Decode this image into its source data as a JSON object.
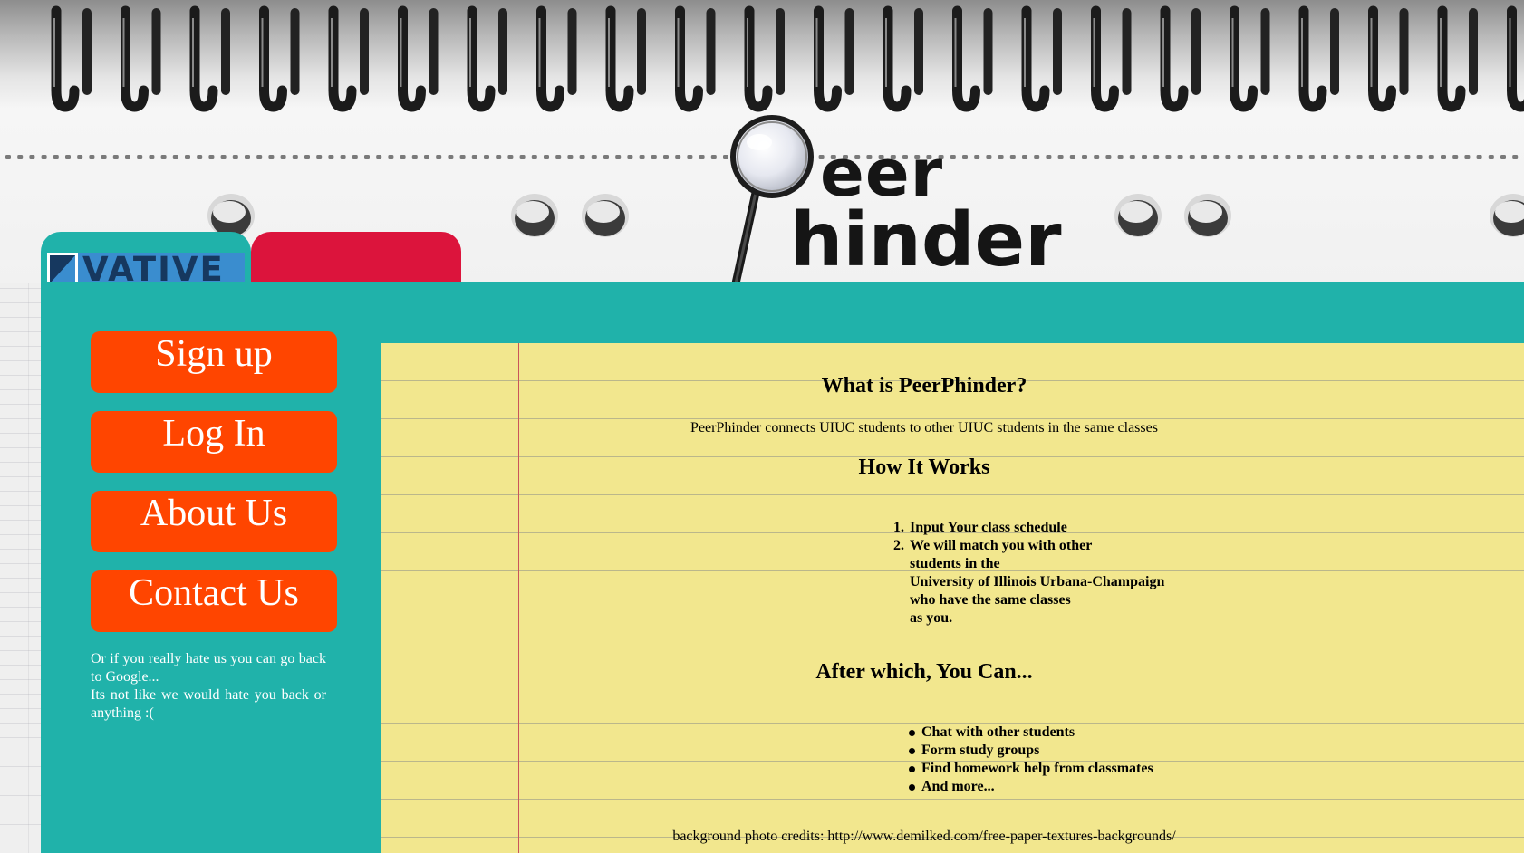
{
  "site": {
    "logo_text_top": "eer",
    "logo_text_bottom": "hinder",
    "partner_logo_text": "VATIVE"
  },
  "nav": {
    "signup_label": "Sign up",
    "login_label": "Log In",
    "about_label": "About Us",
    "contact_label": "Contact Us"
  },
  "side_note": {
    "line1": "Or if you really hate us you can go back to Google...",
    "line2": "Its not like we would hate you back or anything :("
  },
  "content": {
    "what_title": "What is PeerPhinder?",
    "what_text": "PeerPhinder connects UIUC students to other UIUC students in the same classes",
    "how_title": "How It Works",
    "steps": [
      {
        "num": "1.",
        "lines": [
          "Input Your class schedule"
        ]
      },
      {
        "num": "2.",
        "lines": [
          "We will match you with other",
          "students in the",
          "University of Illinois Urbana-Champaign",
          "who have the same classes",
          "as you."
        ]
      }
    ],
    "after_title": "After which, You Can...",
    "bullets": [
      "Chat with other students",
      "Form study groups",
      "Find homework help from classmates",
      "And more..."
    ],
    "credits": "background photo credits: http://www.demilked.com/free-paper-textures-backgrounds/"
  },
  "colors": {
    "panel_teal": "#20b2aa",
    "tab_red": "#dc143c",
    "button_orange": "#ff4500",
    "pad_yellow": "#f2e78e"
  }
}
